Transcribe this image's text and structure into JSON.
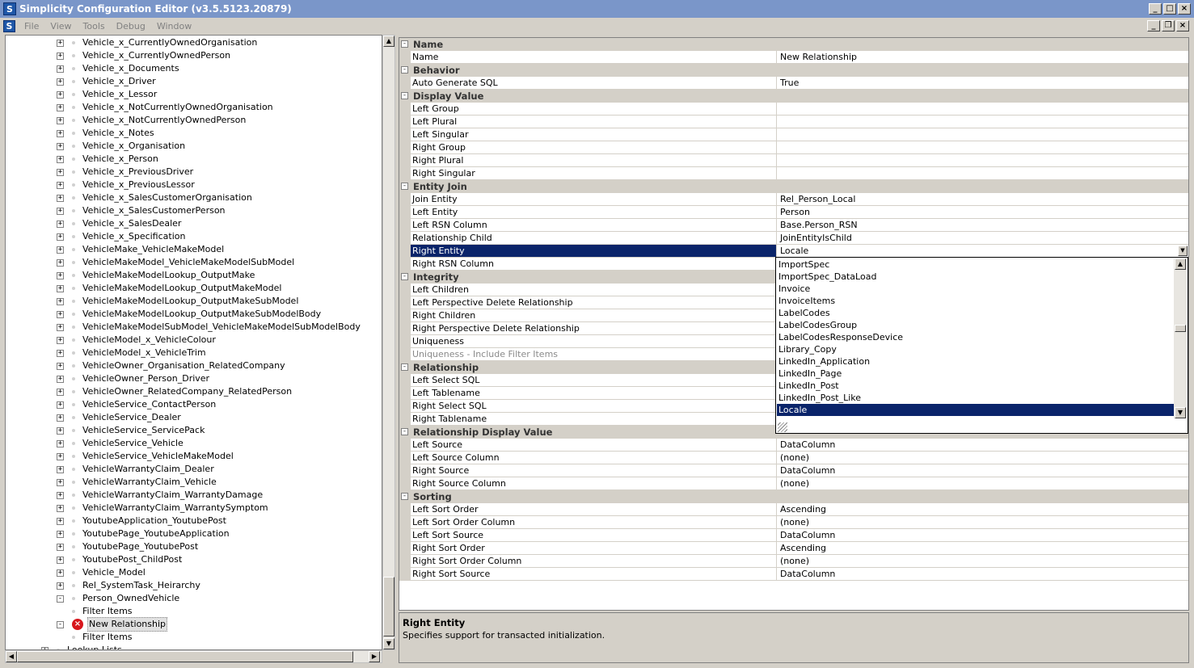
{
  "window": {
    "title": "Simplicity Configuration Editor (v3.5.5123.20879)",
    "icon_letter": "S"
  },
  "menu": [
    "File",
    "View",
    "Tools",
    "Debug",
    "Window"
  ],
  "tree": {
    "items": [
      {
        "label": "Vehicle_x_CurrentlyOwnedOrganisation",
        "level": 1,
        "exp": "+"
      },
      {
        "label": "Vehicle_x_CurrentlyOwnedPerson",
        "level": 1,
        "exp": "+"
      },
      {
        "label": "Vehicle_x_Documents",
        "level": 1,
        "exp": "+"
      },
      {
        "label": "Vehicle_x_Driver",
        "level": 1,
        "exp": "+"
      },
      {
        "label": "Vehicle_x_Lessor",
        "level": 1,
        "exp": "+"
      },
      {
        "label": "Vehicle_x_NotCurrentlyOwnedOrganisation",
        "level": 1,
        "exp": "+"
      },
      {
        "label": "Vehicle_x_NotCurrentlyOwnedPerson",
        "level": 1,
        "exp": "+"
      },
      {
        "label": "Vehicle_x_Notes",
        "level": 1,
        "exp": "+"
      },
      {
        "label": "Vehicle_x_Organisation",
        "level": 1,
        "exp": "+"
      },
      {
        "label": "Vehicle_x_Person",
        "level": 1,
        "exp": "+"
      },
      {
        "label": "Vehicle_x_PreviousDriver",
        "level": 1,
        "exp": "+"
      },
      {
        "label": "Vehicle_x_PreviousLessor",
        "level": 1,
        "exp": "+"
      },
      {
        "label": "Vehicle_x_SalesCustomerOrganisation",
        "level": 1,
        "exp": "+"
      },
      {
        "label": "Vehicle_x_SalesCustomerPerson",
        "level": 1,
        "exp": "+"
      },
      {
        "label": "Vehicle_x_SalesDealer",
        "level": 1,
        "exp": "+"
      },
      {
        "label": "Vehicle_x_Specification",
        "level": 1,
        "exp": "+"
      },
      {
        "label": "VehicleMake_VehicleMakeModel",
        "level": 1,
        "exp": "+"
      },
      {
        "label": "VehicleMakeModel_VehicleMakeModelSubModel",
        "level": 1,
        "exp": "+"
      },
      {
        "label": "VehicleMakeModelLookup_OutputMake",
        "level": 1,
        "exp": "+"
      },
      {
        "label": "VehicleMakeModelLookup_OutputMakeModel",
        "level": 1,
        "exp": "+"
      },
      {
        "label": "VehicleMakeModelLookup_OutputMakeSubModel",
        "level": 1,
        "exp": "+"
      },
      {
        "label": "VehicleMakeModelLookup_OutputMakeSubModelBody",
        "level": 1,
        "exp": "+"
      },
      {
        "label": "VehicleMakeModelSubModel_VehicleMakeModelSubModelBody",
        "level": 1,
        "exp": "+"
      },
      {
        "label": "VehicleModel_x_VehicleColour",
        "level": 1,
        "exp": "+"
      },
      {
        "label": "VehicleModel_x_VehicleTrim",
        "level": 1,
        "exp": "+"
      },
      {
        "label": "VehicleOwner_Organisation_RelatedCompany",
        "level": 1,
        "exp": "+"
      },
      {
        "label": "VehicleOwner_Person_Driver",
        "level": 1,
        "exp": "+"
      },
      {
        "label": "VehicleOwner_RelatedCompany_RelatedPerson",
        "level": 1,
        "exp": "+"
      },
      {
        "label": "VehicleService_ContactPerson",
        "level": 1,
        "exp": "+"
      },
      {
        "label": "VehicleService_Dealer",
        "level": 1,
        "exp": "+"
      },
      {
        "label": "VehicleService_ServicePack",
        "level": 1,
        "exp": "+"
      },
      {
        "label": "VehicleService_Vehicle",
        "level": 1,
        "exp": "+"
      },
      {
        "label": "VehicleService_VehicleMakeModel",
        "level": 1,
        "exp": "+"
      },
      {
        "label": "VehicleWarrantyClaim_Dealer",
        "level": 1,
        "exp": "+"
      },
      {
        "label": "VehicleWarrantyClaim_Vehicle",
        "level": 1,
        "exp": "+"
      },
      {
        "label": "VehicleWarrantyClaim_WarrantyDamage",
        "level": 1,
        "exp": "+"
      },
      {
        "label": "VehicleWarrantyClaim_WarrantySymptom",
        "level": 1,
        "exp": "+"
      },
      {
        "label": "YoutubeApplication_YoutubePost",
        "level": 1,
        "exp": "+"
      },
      {
        "label": "YoutubePage_YoutubeApplication",
        "level": 1,
        "exp": "+"
      },
      {
        "label": "YoutubePage_YoutubePost",
        "level": 1,
        "exp": "+"
      },
      {
        "label": "YoutubePost_ChildPost",
        "level": 1,
        "exp": "+"
      },
      {
        "label": "Vehicle_Model",
        "level": 1,
        "exp": "+"
      },
      {
        "label": "Rel_SystemTask_Heirarchy",
        "level": 1,
        "exp": "+"
      },
      {
        "label": "Person_OwnedVehicle",
        "level": 1,
        "exp": "−"
      },
      {
        "label": "Filter Items",
        "level": 2,
        "exp": ""
      },
      {
        "label": "New Relationship",
        "level": 1,
        "exp": "−",
        "error": true,
        "selected": true
      },
      {
        "label": "Filter Items",
        "level": 2,
        "exp": ""
      },
      {
        "label": "Lookup Lists",
        "level": 0,
        "exp": "+"
      }
    ]
  },
  "grid": {
    "rows": [
      {
        "type": "cat",
        "label": "Name"
      },
      {
        "type": "item",
        "name": "Name",
        "value": "New Relationship"
      },
      {
        "type": "cat",
        "label": "Behavior"
      },
      {
        "type": "item",
        "name": "Auto Generate SQL",
        "value": "True"
      },
      {
        "type": "cat",
        "label": "Display Value"
      },
      {
        "type": "item",
        "name": "Left Group",
        "value": ""
      },
      {
        "type": "item",
        "name": "Left Plural",
        "value": ""
      },
      {
        "type": "item",
        "name": "Left Singular",
        "value": ""
      },
      {
        "type": "item",
        "name": "Right Group",
        "value": ""
      },
      {
        "type": "item",
        "name": "Right Plural",
        "value": ""
      },
      {
        "type": "item",
        "name": "Right Singular",
        "value": ""
      },
      {
        "type": "cat",
        "label": "Entity Join"
      },
      {
        "type": "item",
        "name": "Join Entity",
        "value": "Rel_Person_Local"
      },
      {
        "type": "item",
        "name": "Left Entity",
        "value": "Person"
      },
      {
        "type": "item",
        "name": "Left RSN Column",
        "value": "Base.Person_RSN"
      },
      {
        "type": "item",
        "name": "Relationship Child",
        "value": "JoinEntityIsChild"
      },
      {
        "type": "item",
        "name": "Right Entity",
        "value": "Locale",
        "selected": true,
        "combo": true
      },
      {
        "type": "item",
        "name": "Right RSN Column",
        "value": ""
      },
      {
        "type": "cat",
        "label": "Integrity"
      },
      {
        "type": "item",
        "name": "Left Children",
        "value": ""
      },
      {
        "type": "item",
        "name": "Left Perspective Delete Relationship",
        "value": ""
      },
      {
        "type": "item",
        "name": "Right Children",
        "value": ""
      },
      {
        "type": "item",
        "name": "Right Perspective Delete Relationship",
        "value": ""
      },
      {
        "type": "item",
        "name": "Uniqueness",
        "value": ""
      },
      {
        "type": "item",
        "name": "Uniqueness - Include Filter Items",
        "value": "",
        "disabled": true
      },
      {
        "type": "cat",
        "label": "Relationship"
      },
      {
        "type": "item",
        "name": "Left Select SQL",
        "value": ""
      },
      {
        "type": "item",
        "name": "Left Tablename",
        "value": ""
      },
      {
        "type": "item",
        "name": "Right Select SQL",
        "value": ""
      },
      {
        "type": "item",
        "name": "Right Tablename",
        "value": ""
      },
      {
        "type": "cat",
        "label": "Relationship Display Value"
      },
      {
        "type": "item",
        "name": "Left Source",
        "value": "DataColumn"
      },
      {
        "type": "item",
        "name": "Left Source Column",
        "value": "(none)"
      },
      {
        "type": "item",
        "name": "Right Source",
        "value": "DataColumn"
      },
      {
        "type": "item",
        "name": "Right Source Column",
        "value": "(none)"
      },
      {
        "type": "cat",
        "label": "Sorting"
      },
      {
        "type": "item",
        "name": "Left Sort Order",
        "value": "Ascending"
      },
      {
        "type": "item",
        "name": "Left Sort Order Column",
        "value": "(none)"
      },
      {
        "type": "item",
        "name": "Left Sort Source",
        "value": "DataColumn"
      },
      {
        "type": "item",
        "name": "Right Sort Order",
        "value": "Ascending"
      },
      {
        "type": "item",
        "name": "Right Sort Order Column",
        "value": "(none)"
      },
      {
        "type": "item",
        "name": "Right Sort Source",
        "value": "DataColumn"
      }
    ]
  },
  "dropdown": {
    "options": [
      "ImportSpec",
      "ImportSpec_DataLoad",
      "Invoice",
      "InvoiceItems",
      "LabelCodes",
      "LabelCodesGroup",
      "LabelCodesResponseDevice",
      "Library_Copy",
      "LinkedIn_Application",
      "LinkedIn_Page",
      "LinkedIn_Post",
      "LinkedIn_Post_Like",
      "Locale"
    ],
    "selected": "Locale"
  },
  "help": {
    "title": "Right Entity",
    "text": "Specifies support for transacted initialization."
  }
}
